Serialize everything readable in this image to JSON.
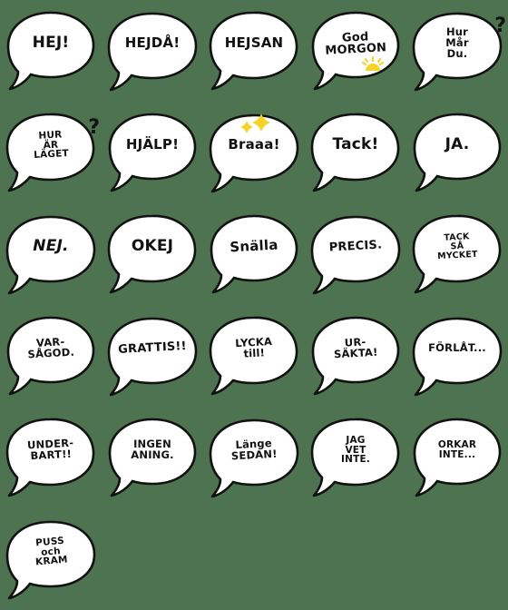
{
  "page": {
    "title": "Swedish speech bubble sticker pack",
    "background_color": "#4d7350",
    "bubble_fill": "#ffffff",
    "bubble_stroke": "#111111",
    "accent_yellow": "#f5d328",
    "columns": 5,
    "rows": 6,
    "sticker_count": 26
  },
  "stickers": [
    {
      "id": "hej",
      "lines": [
        "HEJ!"
      ],
      "size": "s1",
      "style": "",
      "deco": "none"
    },
    {
      "id": "hejda",
      "lines": [
        "HEJDÅ!"
      ],
      "size": "s2",
      "style": "",
      "deco": "none"
    },
    {
      "id": "hejsan",
      "lines": [
        "HEJSAN"
      ],
      "size": "s2",
      "style": "",
      "deco": "none"
    },
    {
      "id": "god-morgon",
      "lines": [
        "God",
        "MORGON"
      ],
      "size": "s3",
      "style": "slant",
      "deco": "sun"
    },
    {
      "id": "hur-mar-du",
      "lines": [
        "Hur",
        "Mår",
        "Du."
      ],
      "size": "s4",
      "style": "",
      "deco": "question"
    },
    {
      "id": "hur-ar-laget",
      "lines": [
        "HUR",
        "ÄR",
        "LÄGET"
      ],
      "size": "s5",
      "style": "slant",
      "deco": "question"
    },
    {
      "id": "hjalp",
      "lines": [
        "HJÄLP!"
      ],
      "size": "s2",
      "style": "",
      "deco": "none"
    },
    {
      "id": "braaa",
      "lines": [
        "Braaa!"
      ],
      "size": "s2",
      "style": "",
      "deco": "sparkles"
    },
    {
      "id": "tack",
      "lines": [
        "Tack!"
      ],
      "size": "s1",
      "style": "",
      "deco": "none"
    },
    {
      "id": "ja",
      "lines": [
        "JA."
      ],
      "size": "s1",
      "style": "",
      "deco": "none"
    },
    {
      "id": "nej",
      "lines": [
        "NEJ."
      ],
      "size": "s1",
      "style": "italic",
      "deco": "none"
    },
    {
      "id": "okej",
      "lines": [
        "OKEJ"
      ],
      "size": "s1",
      "style": "",
      "deco": "none"
    },
    {
      "id": "snalla",
      "lines": [
        "Snälla"
      ],
      "size": "s2",
      "style": "slant",
      "deco": "none"
    },
    {
      "id": "precis",
      "lines": [
        "PRECIS."
      ],
      "size": "s3",
      "style": "slant",
      "deco": "none"
    },
    {
      "id": "tack-sa-mycket",
      "lines": [
        "TACK",
        "SÅ",
        "MYCKET"
      ],
      "size": "s6",
      "style": "slant",
      "deco": "none"
    },
    {
      "id": "varsagod",
      "lines": [
        "VAR-",
        "SÅGOD."
      ],
      "size": "s4",
      "style": "slant",
      "deco": "none"
    },
    {
      "id": "grattis",
      "lines": [
        "GRATTIS!!"
      ],
      "size": "s3",
      "style": "slant",
      "deco": "none"
    },
    {
      "id": "lycka-till",
      "lines": [
        "LYCKA",
        "till!"
      ],
      "size": "s4",
      "style": "slant",
      "deco": "none"
    },
    {
      "id": "ursakta",
      "lines": [
        "UR-",
        "SÄKTA!"
      ],
      "size": "s4",
      "style": "slant",
      "deco": "none"
    },
    {
      "id": "forlat",
      "lines": [
        "FÖRLÅT..."
      ],
      "size": "s4",
      "style": "",
      "deco": "none"
    },
    {
      "id": "underbart",
      "lines": [
        "UNDER-",
        "BART!!"
      ],
      "size": "s4",
      "style": "slant",
      "deco": "none"
    },
    {
      "id": "ingen-aning",
      "lines": [
        "INGEN",
        "ANING."
      ],
      "size": "s4",
      "style": "",
      "deco": "none"
    },
    {
      "id": "lange-sedan",
      "lines": [
        "Länge",
        "SEDAN!"
      ],
      "size": "s4",
      "style": "slant",
      "deco": "none"
    },
    {
      "id": "jag-vet-inte",
      "lines": [
        "JAG",
        "VET",
        "INTE."
      ],
      "size": "s5",
      "style": "",
      "deco": "none"
    },
    {
      "id": "orkar-inte",
      "lines": [
        "ORKAR",
        "INTE..."
      ],
      "size": "s5",
      "style": "",
      "deco": "none"
    },
    {
      "id": "puss-och-kram",
      "lines": [
        "PUSS",
        "och",
        "KRAM"
      ],
      "size": "s5",
      "style": "slant2",
      "deco": "none"
    }
  ]
}
